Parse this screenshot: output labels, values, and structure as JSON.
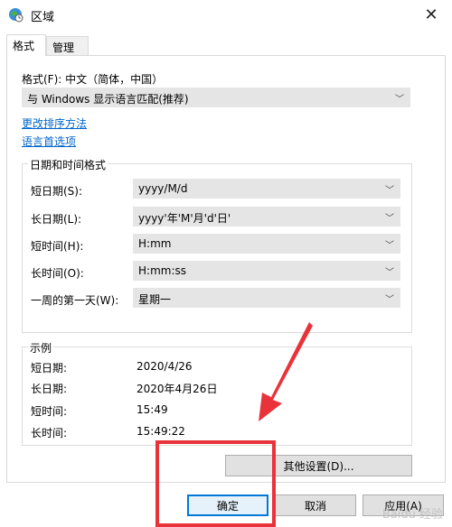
{
  "window": {
    "title": "区域",
    "close_glyph": "✕"
  },
  "tabs": [
    {
      "label": "格式",
      "active": true
    },
    {
      "label": "管理",
      "active": false
    }
  ],
  "format": {
    "label": "格式(F): 中文（简体，中国）",
    "select_value": "与 Windows 显示语言匹配(推荐)"
  },
  "links": {
    "sort": "更改排序方法",
    "language": "语言首选项"
  },
  "datetime_group": {
    "title": "日期和时间格式",
    "rows": [
      {
        "label": "短日期(S):",
        "value": "yyyy/M/d"
      },
      {
        "label": "长日期(L):",
        "value": "yyyy'年'M'月'd'日'"
      },
      {
        "label": "短时间(H):",
        "value": "H:mm"
      },
      {
        "label": "长时间(O):",
        "value": "H:mm:ss"
      },
      {
        "label": "一周的第一天(W):",
        "value": "星期一"
      }
    ]
  },
  "example_group": {
    "title": "示例",
    "rows": [
      {
        "label": "短日期:",
        "value": "2020/4/26"
      },
      {
        "label": "长日期:",
        "value": "2020年4月26日"
      },
      {
        "label": "短时间:",
        "value": "15:49"
      },
      {
        "label": "长时间:",
        "value": "15:49:22"
      }
    ]
  },
  "buttons": {
    "other": "其他设置(D)...",
    "ok": "确定",
    "cancel": "取消",
    "apply": "应用(A)"
  },
  "watermark": "Baidu 经验",
  "annotation": {
    "color": "#e8333b"
  }
}
